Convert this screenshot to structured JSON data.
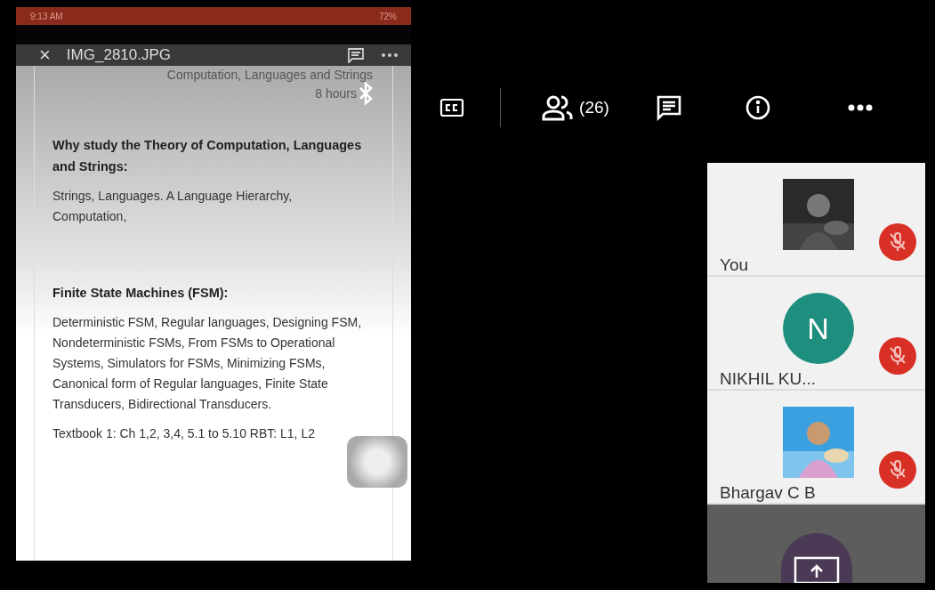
{
  "shared_screen": {
    "status_bar": {
      "time": "9:13 AM",
      "battery": "72%"
    },
    "viewer_bar": {
      "close": "×",
      "title": "IMG_2810.JPG"
    },
    "document": {
      "heading": "Computation, Languages and Strings",
      "duration": "8 hours",
      "sections": [
        {
          "title": "Why study the Theory of Computation, Languages and Strings:",
          "body": "Strings, Languages. A Language Hierarchy, Computation,"
        },
        {
          "title": "Finite State Machines (FSM):",
          "body": "Deterministic FSM, Regular languages, Designing FSM, Nondeterministic FSMs, From FSMs to Operational Systems, Simulators for FSMs, Minimizing FSMs, Canonical form of Regular languages, Finite State Transducers, Bidirectional Transducers."
        }
      ],
      "footer": "Textbook 1: Ch 1,2, 3,4, 5.1 to 5.10 RBT: L1, L2"
    }
  },
  "call_toolbar": {
    "participant_count": "(26)"
  },
  "participants": [
    {
      "name": "You",
      "muted": true
    },
    {
      "name": "NIKHIL KU...",
      "avatar": {
        "kind": "initial",
        "letter": "N",
        "color": "#1e8f7e"
      },
      "muted": true
    },
    {
      "name": "Bhargav C B",
      "muted": true
    }
  ]
}
